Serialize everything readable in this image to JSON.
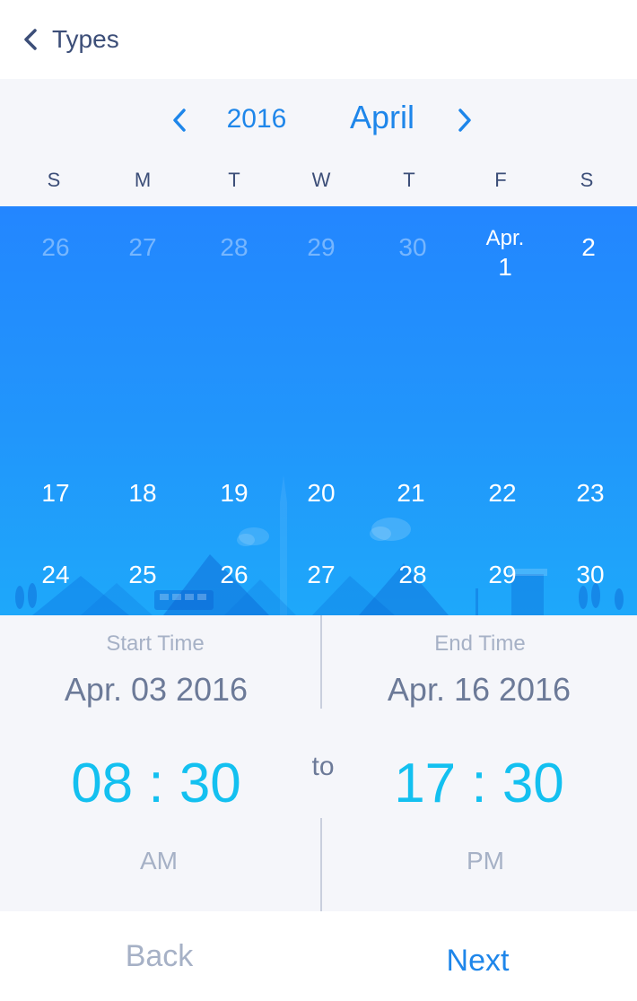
{
  "header": {
    "back_label": "Types"
  },
  "calendar": {
    "year": "2016",
    "month": "April",
    "weekdays": [
      "S",
      "M",
      "T",
      "W",
      "T",
      "F",
      "S"
    ],
    "rows": [
      [
        {
          "label": "26",
          "faded": true
        },
        {
          "label": "27",
          "faded": true
        },
        {
          "label": "28",
          "faded": true
        },
        {
          "label": "29",
          "faded": true
        },
        {
          "label": "30",
          "faded": true
        },
        {
          "label": "1",
          "prefix": "Apr.",
          "faded": false
        },
        {
          "label": "2",
          "faded": false
        }
      ],
      [
        {
          "label": "17",
          "faded": false
        },
        {
          "label": "18",
          "faded": false
        },
        {
          "label": "19",
          "faded": false
        },
        {
          "label": "20",
          "faded": false
        },
        {
          "label": "21",
          "faded": false
        },
        {
          "label": "22",
          "faded": false
        },
        {
          "label": "23",
          "faded": false
        }
      ],
      [
        {
          "label": "24",
          "faded": false
        },
        {
          "label": "25",
          "faded": false
        },
        {
          "label": "26",
          "faded": false
        },
        {
          "label": "27",
          "faded": false
        },
        {
          "label": "28",
          "faded": false
        },
        {
          "label": "29",
          "faded": false
        },
        {
          "label": "30",
          "faded": false
        }
      ]
    ]
  },
  "time": {
    "start_label": "Start Time",
    "start_date": "Apr. 03  2016",
    "start_time": "08 : 30",
    "start_period": "AM",
    "to_label": "to",
    "end_label": "End Time",
    "end_date": "Apr. 16  2016",
    "end_time": "17 : 30",
    "end_period": "PM"
  },
  "footer": {
    "back": "Back",
    "next": "Next"
  },
  "colors": {
    "accent": "#1e86ea",
    "time": "#13c0f0",
    "grid_top": "#2386ff",
    "grid_bottom": "#1ea8fa"
  }
}
